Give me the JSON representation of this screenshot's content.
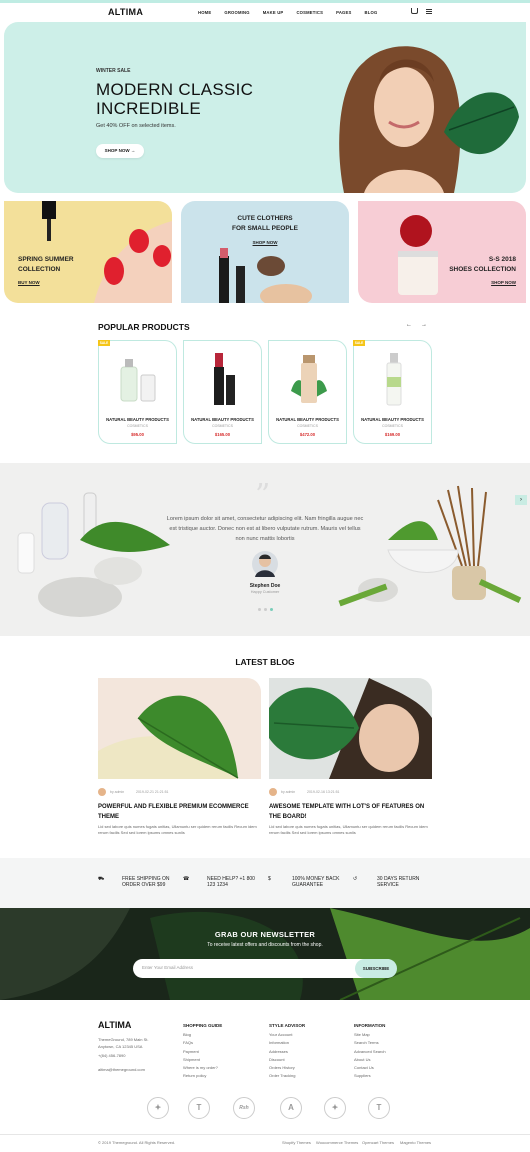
{
  "header": {
    "logo": "ALTIMA",
    "nav": [
      "HOME",
      "GROOMING",
      "MAKE UP",
      "COSMETICS",
      "PAGES",
      "BLOG"
    ]
  },
  "hero": {
    "tag": "WINTER SALE",
    "title_line1": "MODERN CLASSIC",
    "title_line2": "INCREDIBLE",
    "subtitle": "Get 40% OFF on selected items.",
    "button": "SHOP NOW →"
  },
  "promos": [
    {
      "line1": "SPRING SUMMER",
      "line2": "COLLECTION",
      "link": "BUY NOW"
    },
    {
      "line1": "CUTE CLOTHERS",
      "line2": "FOR SMALL PEOPLE",
      "link": "SHOP NOW"
    },
    {
      "line1": "S-S 2018",
      "line2": "SHOES COLLECTION",
      "link": "SHOP NOW"
    }
  ],
  "popular": {
    "title": "POPULAR PRODUCTS",
    "prev": "←",
    "next": "→",
    "products": [
      {
        "badge": "SALE",
        "name": "NATURAL BEAUTY PRODUCTS",
        "category": "COSMETICS",
        "price": "$95.00"
      },
      {
        "badge": "",
        "name": "NATURAL BEAUTY PRODUCTS",
        "category": "COSMETICS",
        "price": "$165.00"
      },
      {
        "badge": "",
        "name": "NATURAL BEAUTY PRODUCTS",
        "category": "COSMETICS",
        "price": "$472.00"
      },
      {
        "badge": "SALE",
        "name": "NATURAL BEAUTY PRODUCTS",
        "category": "COSMETICS",
        "price": "$169.00"
      }
    ]
  },
  "testimonial": {
    "quote_mark": "”",
    "text": "Lorem ipsum dolor sit amet, consectetur adipiscing elit. Nam fringilla augue nec est tristique auctor. Donec non est at libero vulputate rutrum. Mauris vel tellus non nunc mattis lobortis",
    "name": "Stephen Doe",
    "role": "Happy Customer"
  },
  "blog": {
    "title": "LATEST BLOG",
    "posts": [
      {
        "author": "by admin",
        "date": "2019-02-21 21:21:51",
        "title": "POWERFUL AND FLEXIBLE PREMIUM ECOMMERCE THEME",
        "excerpt": "Lid sed labore quis numes fugats unitias, Ullamuntu ser quidem rerum facilis Recum idem rerum facilis Sed sed lorem ipsums omnes sunlis"
      },
      {
        "author": "by admin",
        "date": "2019-02-16 13:21:51",
        "title": "AWESOME TEMPLATE WITH LOT'S OF FEATURES ON THE BOARD!",
        "excerpt": "Lid sed labore quis numes fugats unitias, Ullamuntu ser quidem rerum facilis Recum idem rerum facilis Sed sed lorem ipsums omnes sunlis"
      }
    ]
  },
  "features": [
    {
      "icon": "⛟",
      "l1": "FREE SHIPPING ON",
      "l2": "ORDER OVER $99"
    },
    {
      "icon": "☎",
      "l1": "NEED HELP? +1 800",
      "l2": "123 1234"
    },
    {
      "icon": "$",
      "l1": "100% MONEY BACK",
      "l2": "GUARANTEE"
    },
    {
      "icon": "↺",
      "l1": "30 DAYS RETURN",
      "l2": "SERVICE"
    }
  ],
  "newsletter": {
    "title": "GRAB OUR NEWSLETTER",
    "subtitle": "To receive latest offers and discounts from the shop.",
    "placeholder": "Enter Your Email Address",
    "button": "SUBSCRIBE"
  },
  "footer": {
    "logo": "ALTIMA",
    "address": [
      "ThemeGround, 789 Main St.",
      "Anytown, CA 12345 USA"
    ],
    "phone": "+(84) 456-7890",
    "email": "altima@themeground.com",
    "cols": [
      {
        "title": "SHOPPING GUIDE",
        "items": [
          "Blog",
          "FAQs",
          "Payment",
          "Shipment",
          "Where is my order?",
          "Return policy"
        ]
      },
      {
        "title": "STYLE ADVISOR",
        "items": [
          "Your Account",
          "Information",
          "Addresses",
          "Discount",
          "Orders History",
          "Order Tracking"
        ]
      },
      {
        "title": "INFORMATION",
        "items": [
          "Site Map",
          "Search Terms",
          "Advanced Search",
          "About Us",
          "Contact Us",
          "Suppliers"
        ]
      }
    ],
    "brands": [
      "✦",
      "T",
      "Rsh",
      "A",
      "✦",
      "T"
    ],
    "copyright": "© 2019 Themeground. All Rights Reserved.",
    "links": [
      "Shopify Themes",
      "Woocommerce Themes",
      "Opencart Themes",
      "Magento Themes"
    ]
  },
  "colors": {
    "mint": "#cdefe8",
    "yellow": "#f3e09a",
    "blue": "#cbe3eb",
    "pink": "#f7cdd5",
    "price": "#d62d2d"
  }
}
